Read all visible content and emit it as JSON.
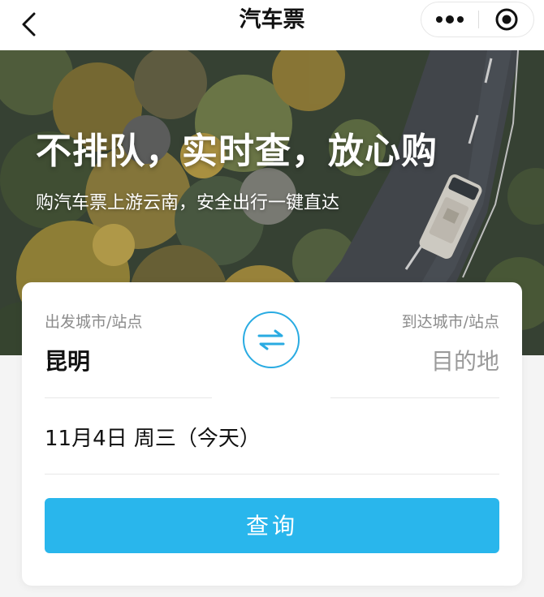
{
  "navbar": {
    "title": "汽车票",
    "back_icon": "chevron-left-icon",
    "more_icon": "more-dots-icon",
    "close_icon": "target-close-icon"
  },
  "hero": {
    "headline": "不排队，实时查，放心购",
    "subtitle": "购汽车票上游云南，安全出行一键直达"
  },
  "search": {
    "from_label": "出发城市/站点",
    "from_value": "昆明",
    "to_label": "到达城市/站点",
    "to_placeholder": "目的地",
    "swap_icon": "swap-arrows-icon",
    "date": "11月4日  周三（今天）",
    "query_label": "查询"
  },
  "colors": {
    "accent": "#29b6ec",
    "swap_ring": "#29abe2"
  }
}
